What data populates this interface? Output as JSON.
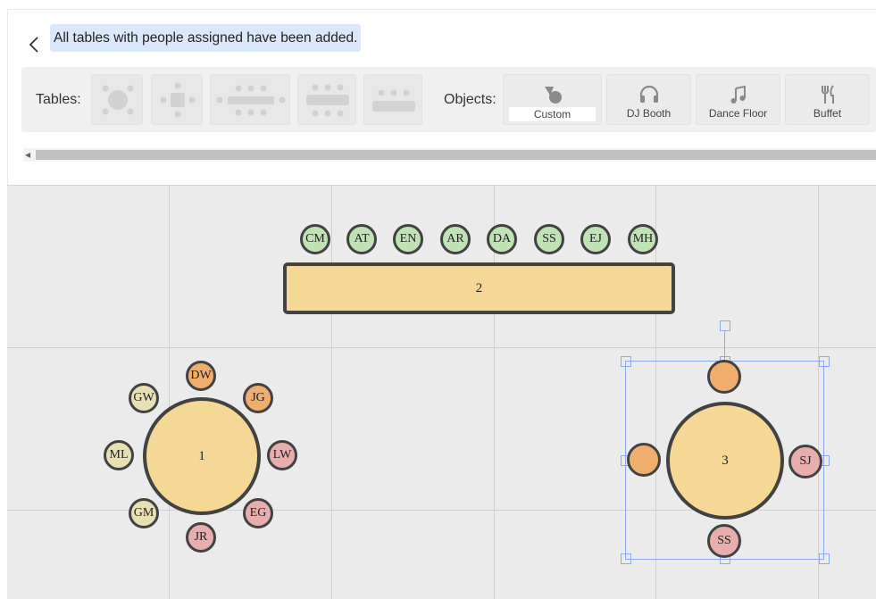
{
  "notice": {
    "text": "All tables with people assigned have been added."
  },
  "toolbar": {
    "tables_label": "Tables:",
    "objects_label": "Objects:",
    "objects": [
      {
        "label": "Custom",
        "icon": "custom-shape-icon"
      },
      {
        "label": "DJ Booth",
        "icon": "headphones-icon"
      },
      {
        "label": "Dance Floor",
        "icon": "music-note-icon"
      },
      {
        "label": "Buffet",
        "icon": "fork-knife-icon"
      }
    ],
    "table_types": [
      "round-table",
      "square-table",
      "long-table-end-seats",
      "rect-table-both-sides",
      "rect-table-one-side"
    ]
  },
  "canvas": {
    "tables": [
      {
        "number": "1",
        "shape": "round",
        "seats": [
          {
            "initials": "DW",
            "color": "#f0ae6e"
          },
          {
            "initials": "JG",
            "color": "#f0ae6e"
          },
          {
            "initials": "LW",
            "color": "#e8adad"
          },
          {
            "initials": "EG",
            "color": "#e8adad"
          },
          {
            "initials": "JR",
            "color": "#e8adad"
          },
          {
            "initials": "GM",
            "color": "#e8e0b2"
          },
          {
            "initials": "ML",
            "color": "#e8e0b2"
          },
          {
            "initials": "GW",
            "color": "#e8e0b2"
          }
        ]
      },
      {
        "number": "2",
        "shape": "rectangle",
        "seats": [
          {
            "initials": "CM",
            "color": "#bfe3b4"
          },
          {
            "initials": "AT",
            "color": "#bfe3b4"
          },
          {
            "initials": "EN",
            "color": "#bfe3b4"
          },
          {
            "initials": "AR",
            "color": "#bfe3b4"
          },
          {
            "initials": "DA",
            "color": "#bfe3b4"
          },
          {
            "initials": "SS",
            "color": "#bfe3b4"
          },
          {
            "initials": "EJ",
            "color": "#bfe3b4"
          },
          {
            "initials": "MH",
            "color": "#bfe3b4"
          }
        ]
      },
      {
        "number": "3",
        "shape": "round",
        "selected": true,
        "seats": [
          {
            "initials": "",
            "color": "#f0ae6e"
          },
          {
            "initials": "SJ",
            "color": "#e8adad"
          },
          {
            "initials": "SS",
            "color": "#e8adad"
          },
          {
            "initials": "",
            "color": "#f0ae6e"
          }
        ]
      }
    ]
  }
}
